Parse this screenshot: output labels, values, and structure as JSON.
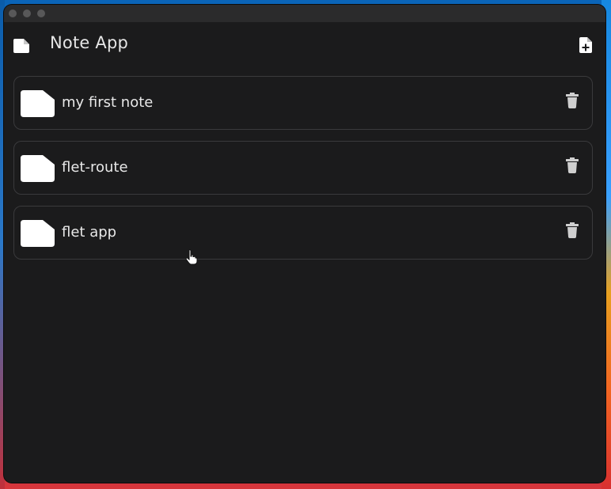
{
  "window": {
    "app_title": "Note App"
  },
  "icons": {
    "lead": "note-icon",
    "add": "note-add-icon",
    "item": "note-icon",
    "delete": "trash-icon"
  },
  "colors": {
    "window_bg": "#1b1b1c",
    "card_border": "#3a3a3c",
    "text": "#e8e8e8",
    "icon": "#ffffff"
  },
  "notes": [
    {
      "title": "my first note"
    },
    {
      "title": "flet-route"
    },
    {
      "title": "flet app"
    }
  ]
}
